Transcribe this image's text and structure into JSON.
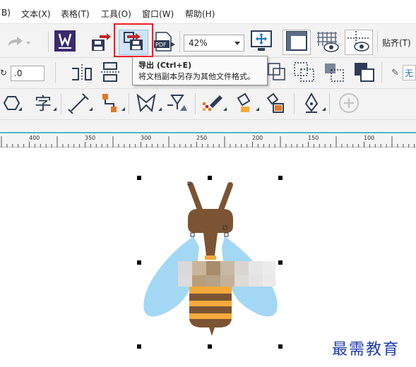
{
  "menu": {
    "items": [
      "B)",
      "文本(X)",
      "表格(T)",
      "工具(O)",
      "窗口(W)",
      "帮助(H)"
    ]
  },
  "toolbar": {
    "zoom_value": "42%",
    "snap_label": "贴齐(T)",
    "export_tooltip_title": "导出 (Ctrl+E)",
    "export_tooltip_desc": "将文档副本另存为其他文件格式。",
    "pdf_label": "PDF"
  },
  "property_bar": {
    "angle_value": ".0",
    "none_label": "无"
  },
  "ruler": {
    "labels": [
      "400",
      "350",
      "300",
      "250",
      "200",
      "150",
      "100"
    ]
  },
  "watermark": "最需教育",
  "colors": {
    "accent_teal": "#4fb6c8",
    "highlight_red": "#e8202a",
    "bee_brown": "#7b5433",
    "bee_yellow": "#f5a93a",
    "wing_blue": "#a3d8f5"
  }
}
